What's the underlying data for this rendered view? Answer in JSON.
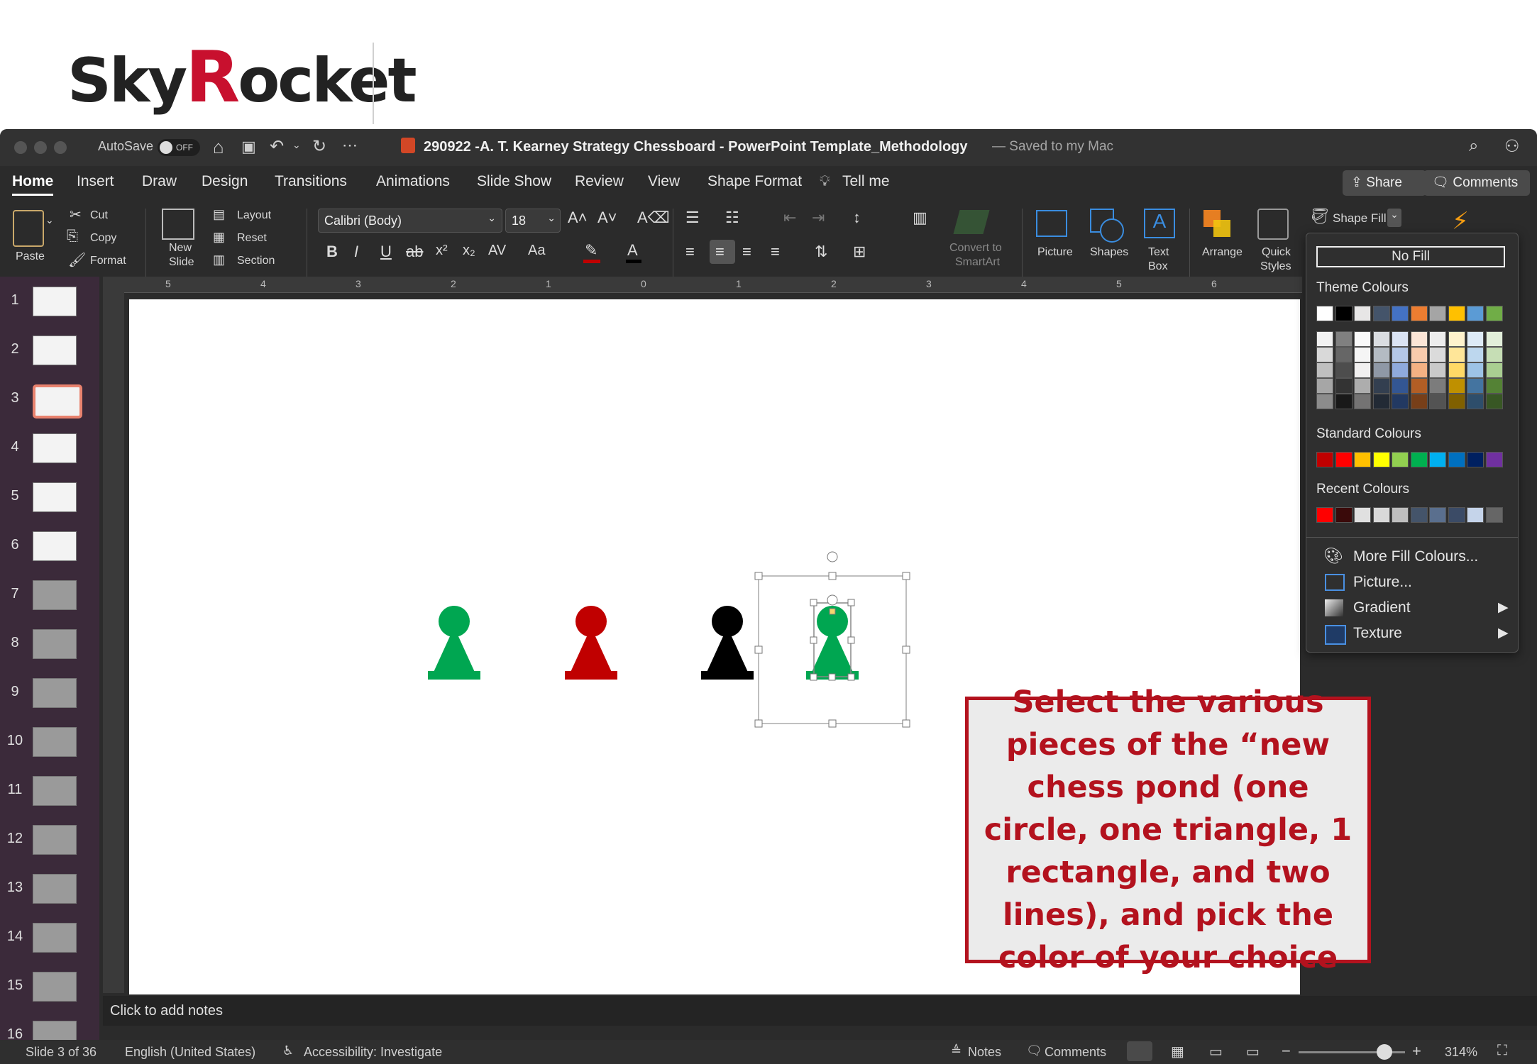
{
  "logo": {
    "part1": "Sky",
    "part2": "R",
    "part3": "ocket"
  },
  "titlebar": {
    "autosave_label": "AutoSave",
    "autosave_state": "OFF",
    "doc_title": "290922 -A. T. Kearney Strategy Chessboard - PowerPoint Template_Methodology",
    "saved_status": "— Saved to my Mac"
  },
  "tabs": [
    "Home",
    "Insert",
    "Draw",
    "Design",
    "Transitions",
    "Animations",
    "Slide Show",
    "Review",
    "View",
    "Shape Format",
    "Tell me"
  ],
  "share": {
    "share_label": "Share",
    "comments_label": "Comments"
  },
  "ribbon": {
    "paste": "Paste",
    "cut": "Cut",
    "copy": "Copy",
    "format": "Format",
    "new_slide_1": "New",
    "new_slide_2": "Slide",
    "layout": "Layout",
    "reset": "Reset",
    "section": "Section",
    "font_name": "Calibri (Body)",
    "font_size": "18",
    "bold": "B",
    "italic": "I",
    "underline": "U",
    "strike": "ab",
    "superscript": "x²",
    "subscript": "x₂",
    "spacing": "AV",
    "case": "Aa",
    "convert_1": "Convert to",
    "convert_2": "SmartArt",
    "picture": "Picture",
    "shapes": "Shapes",
    "textbox_1": "Text",
    "textbox_2": "Box",
    "arrange": "Arrange",
    "quick_styles_1": "Quick",
    "quick_styles_2": "Styles",
    "shape_fill": "Shape Fill"
  },
  "ruler_ticks": [
    "5",
    "4",
    "3",
    "2",
    "1",
    "0",
    "1",
    "2",
    "3",
    "4",
    "5",
    "6"
  ],
  "thumbnails": [
    "1",
    "2",
    "3",
    "4",
    "5",
    "6",
    "7",
    "8",
    "9",
    "10",
    "11",
    "12",
    "13",
    "14",
    "15",
    "16"
  ],
  "selected_slide": 3,
  "fill_menu": {
    "no_fill": "No Fill",
    "theme_title": "Theme Colours",
    "standard_title": "Standard Colours",
    "recent_title": "Recent Colours",
    "more": "More Fill Colours...",
    "picture": "Picture...",
    "gradient": "Gradient",
    "texture": "Texture",
    "theme_top": [
      "#ffffff",
      "#000000",
      "#e7e6e6",
      "#44546a",
      "#4472c4",
      "#ed7d31",
      "#a5a5a5",
      "#ffc000",
      "#5b9bd5",
      "#70ad47"
    ],
    "standard": [
      "#c00000",
      "#ff0000",
      "#ffc000",
      "#ffff00",
      "#92d050",
      "#00b050",
      "#00b0f0",
      "#0070c0",
      "#002060",
      "#7030a0"
    ],
    "recent": [
      "#ff0000",
      "#3a0a0a",
      "#e0e0e0",
      "#d9d9d9",
      "#bfbfbf",
      "#44546a",
      "#5a6f8e",
      "#3b4b66",
      "#c5d4ea",
      "#666666"
    ]
  },
  "pawn_colors": [
    "#00a651",
    "#c00000",
    "#000000",
    "#00a651"
  ],
  "callout_text": "Select the various pieces of the “new chess pond (one circle, one triangle, 1 rectangle, and two lines), and pick the color of your choice",
  "notes_placeholder": "Click to add notes",
  "status": {
    "slide_info": "Slide 3 of 36",
    "language": "English (United States)",
    "accessibility": "Accessibility: Investigate",
    "notes": "Notes",
    "comments": "Comments",
    "zoom": "314%"
  }
}
